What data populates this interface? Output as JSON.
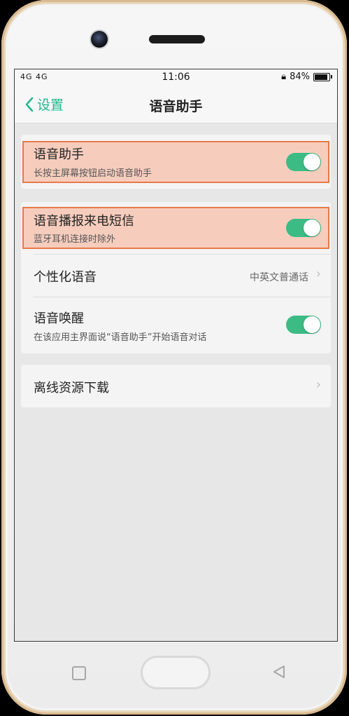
{
  "status": {
    "signal": "4G 4G",
    "time": "11:06",
    "battery": "84%",
    "battery_level": 0.84
  },
  "nav": {
    "back_label": "设置",
    "title": "语音助手"
  },
  "group1": {
    "item": {
      "label": "语音助手",
      "desc": "长按主屏幕按钮启动语音助手",
      "toggle_on": true
    }
  },
  "group2": {
    "items": [
      {
        "label": "语音播报来电短信",
        "desc": "蓝牙耳机连接时除外",
        "toggle_on": true
      },
      {
        "label": "个性化语音",
        "value": "中英文普通话"
      },
      {
        "label": "语音唤醒",
        "desc": "在该应用主界面说“语音助手”开始语音对话",
        "toggle_on": true
      }
    ]
  },
  "group3": {
    "item": {
      "label": "离线资源下载"
    }
  },
  "colors": {
    "accent": "#1fb98a",
    "highlight_border": "#e8794a",
    "highlight_fill": "#f7b89f"
  }
}
